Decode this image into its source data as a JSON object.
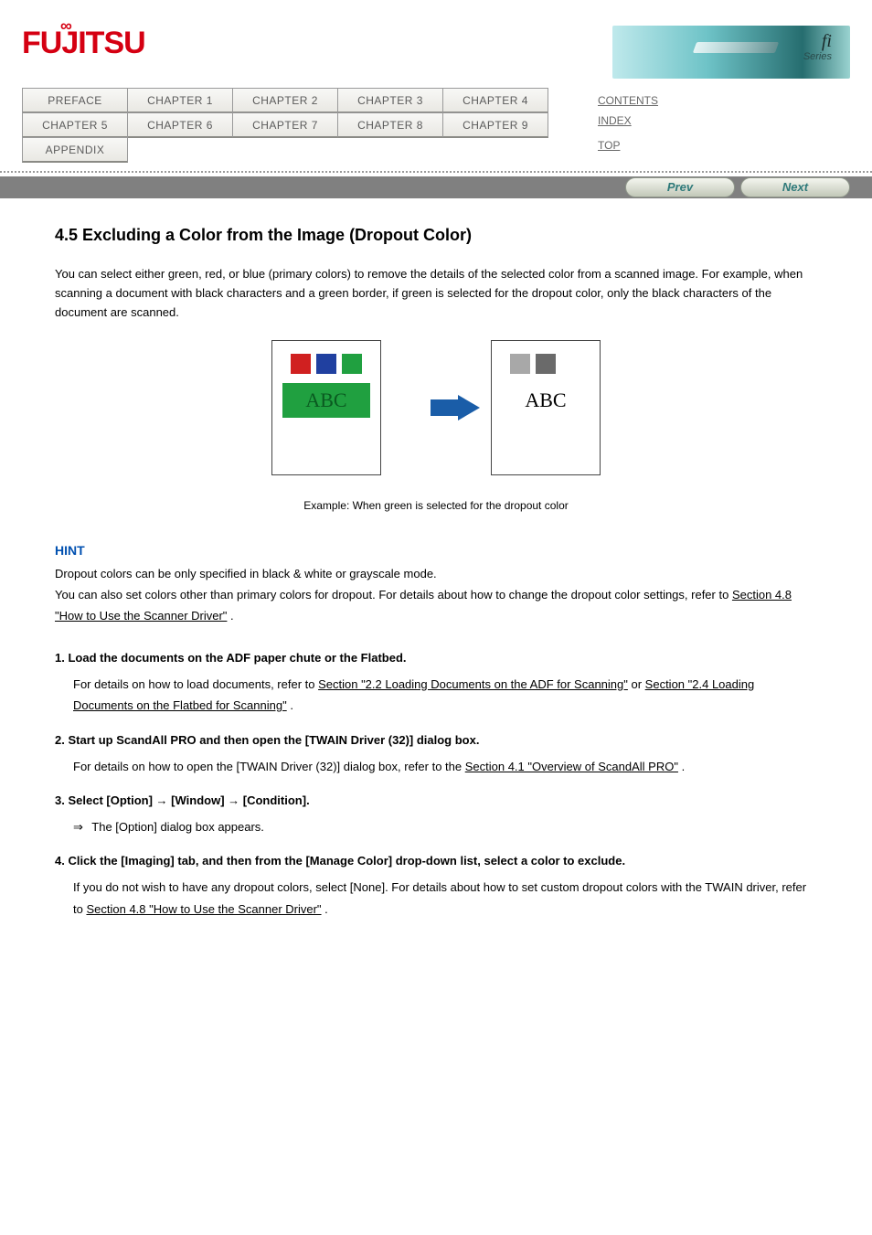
{
  "header": {
    "logo_text": "FUJITSU",
    "banner_fi": "fi",
    "banner_series": "Series"
  },
  "nav": {
    "tabs": [
      "PREFACE",
      "CHAPTER 1",
      "CHAPTER 2",
      "CHAPTER 3",
      "CHAPTER 4",
      "CHAPTER 5",
      "CHAPTER 6",
      "CHAPTER 7",
      "CHAPTER 8",
      "CHAPTER 9",
      "APPENDIX"
    ],
    "side_links": {
      "contents": "CONTENTS",
      "index": "INDEX",
      "top": "TOP"
    }
  },
  "pager": {
    "prev": "Prev",
    "next": "Next"
  },
  "content": {
    "title": "4.5 Excluding a Color from the Image (Dropout Color)",
    "intro": "You can select either green, red, or blue (primary colors) to remove the details of the selected color from a scanned image. For example, when scanning a document with black characters and a green border, if green is selected for the dropout color, only the black characters of the document are scanned.",
    "diagram": {
      "abc": "ABC"
    },
    "example_caption": "Example: When green is selected for the dropout color",
    "hint": {
      "label": "HINT",
      "text_1": "Dropout colors can be only specified in black & white or grayscale mode.",
      "text_2_prefix": "You can also set colors other than primary colors for dropout. For details about how to change the dropout color settings, refer to ",
      "text_2_link": "Section 4.8 \"How to Use the Scanner Driver\"",
      "text_2_suffix": "."
    },
    "steps": {
      "s1": {
        "num": "1.",
        "body": "Load the documents on the ADF paper chute or the Flatbed.",
        "ref_prefix": "For details on how to load documents, refer to ",
        "ref_link": "Section \"2.2 Loading Documents on the ADF for Scanning\"",
        "ref_mid": " or ",
        "ref_link2": "Section \"2.4 Loading Documents on the Flatbed for Scanning\"",
        "ref_suffix": "."
      },
      "s2": {
        "num": "2.",
        "body": "Start up ScandAll PRO and then open the [TWAIN Driver (32)] dialog box.",
        "ref_prefix": "For details on how to open the [TWAIN Driver (32)] dialog box, refer to the ",
        "ref_link": "Section 4.1 \"Overview of ScandAll PRO\"",
        "ref_suffix": "."
      },
      "s3": {
        "num": "3.",
        "body_prefix": "Select [Option] ",
        "arrow": "→",
        "body_mid1": " [Window] ",
        "body_mid2": " [Condition].",
        "result": "The [Option] dialog box appears."
      },
      "s4": {
        "num": "4.",
        "body": "Click the [Imaging] tab, and then from the [Manage Color] drop-down list, select a color to exclude.",
        "note_prefix": "If you do not wish to have any dropout colors, select [None]. For details about how to set custom dropout colors with the TWAIN driver, refer to ",
        "note_link": "Section 4.8 \"How to Use the Scanner Driver\"",
        "note_suffix": "."
      }
    }
  }
}
